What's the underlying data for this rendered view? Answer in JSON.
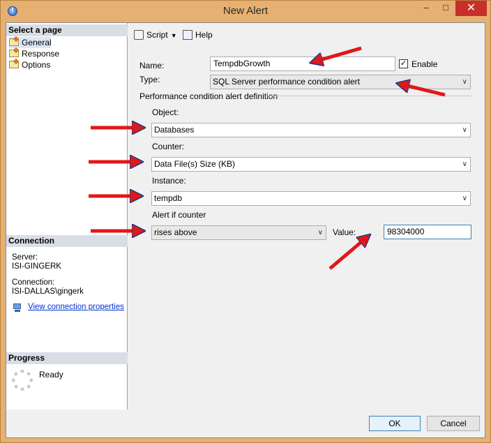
{
  "window": {
    "title": "New Alert",
    "minimize_glyph": "–",
    "maximize_glyph": "□",
    "close_glyph": "✕"
  },
  "sidebar": {
    "select_page_header": "Select a page",
    "pages": [
      {
        "label": "General",
        "selected": true,
        "icon": "page-icon"
      },
      {
        "label": "Response",
        "selected": false,
        "icon": "page-icon"
      },
      {
        "label": "Options",
        "selected": false,
        "icon": "page-icon"
      }
    ],
    "connection_header": "Connection",
    "server_label": "Server:",
    "server_value": "ISI-GINGERK",
    "connection_label": "Connection:",
    "connection_value": "ISI-DALLAS\\gingerk",
    "view_props_link": "View connection properties",
    "progress_header": "Progress",
    "progress_status": "Ready"
  },
  "toolbar": {
    "script_label": "Script",
    "help_label": "Help"
  },
  "form": {
    "name_label": "Name:",
    "name_value": "TempdbGrowth",
    "enable_label": "Enable",
    "enable_checked": true,
    "check_glyph": "✓",
    "type_label": "Type:",
    "type_value": "SQL Server performance condition alert",
    "group_title": "Performance condition alert definition",
    "object_label": "Object:",
    "object_value": "Databases",
    "counter_label": "Counter:",
    "counter_value": "Data File(s) Size (KB)",
    "instance_label": "Instance:",
    "instance_value": "tempdb",
    "alert_if_label": "Alert if counter",
    "alert_if_value": "rises above",
    "value_label": "Value:",
    "value_value": "98304000",
    "dropdown_glyph": "∨"
  },
  "footer": {
    "ok_label": "OK",
    "cancel_label": "Cancel"
  },
  "colors": {
    "annotation_arrow": "#e01818",
    "window_frame": "#e6b072",
    "close_button": "#c7302a",
    "link": "#0033cc"
  }
}
